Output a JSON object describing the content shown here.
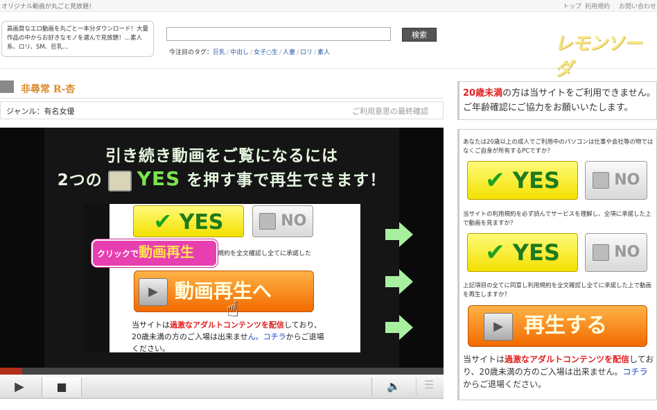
{
  "topbar": {
    "tagline": "オリジナル動画が丸ごと見放題！",
    "links": [
      "トップ",
      "利用規約",
      "お問い合わせ"
    ]
  },
  "header": {
    "description": "高画質なエロ動画を丸ごと一本分ダウンロード！大量作品の中からお好きなモノを選んで見放題！…素人系、ロリ、SM、巨乳…",
    "search_placeholder": "",
    "search_button": "検索",
    "tags_label": "今注目のタグ：",
    "tags": [
      "巨乳",
      "中出し",
      "女子○生",
      "人妻",
      "ロリ",
      "素人"
    ],
    "logo": "レモンソーダ"
  },
  "content": {
    "title": "非尋常 R-杏",
    "genre": "ジャンル：有名女優",
    "final_confirm_link": "ご利用意思の最終確認"
  },
  "video": {
    "headline_line1": "引き続き動画をご覧になるには",
    "headline_line2_pre": "2つの",
    "headline_line2_yes": "YES",
    "headline_line2_post": "を押す事で再生できます！",
    "demo": {
      "yes": "YES",
      "no": "NO",
      "terms_fragment": "規約を全文確認し全てに承諾した",
      "bubble_pre": "クリックで",
      "bubble_main": "動画再生",
      "play_label": "動画再生へ",
      "warn_pre": "当サイトは",
      "warn_red": "過激なアダルトコンテンツを配信",
      "warn_mid": "しており、20歳未満の方のご入場は出来ませ",
      "warn_blue": "ん。コチラ",
      "warn_post": "からご退場ください。"
    },
    "progress_percent": 5
  },
  "sidebar": {
    "age_warning_red": "20歳未満",
    "age_warning_rest1": "の方は当サイトをご利用できません。",
    "age_warning_rest2": "ご年齢確認にご協力をお願いいたします。",
    "question1": "あなたは20歳以上の成人でご利用中のパソコンは仕事や会社等の物ではなくご自身が所有するPCですか？",
    "question2": "当サイトの利用規約を必ず読んでサービスを理解し、全項に承諾した上で動画を見ますか？",
    "question3": "上記項目の全てに同意し利用規約を全文確認し全てに承諾した上で動画を再生しますか？",
    "yes_label": "YES",
    "no_label": "NO",
    "play_label": "再生する",
    "bottom_pre": "当サイトは",
    "bottom_red": "過激なアダルトコンテンツを配信",
    "bottom_mid": "しており、20歳未満の方のご入場は出来ません。",
    "bottom_blue": "コチラ",
    "bottom_post": "からご退場ください。"
  },
  "colors": {
    "accent_orange": "#d98a2a",
    "yes_yellow": "#f3e000",
    "play_orange": "#f26a00",
    "warn_red": "#e02020",
    "link_blue": "#2a5aa8"
  }
}
